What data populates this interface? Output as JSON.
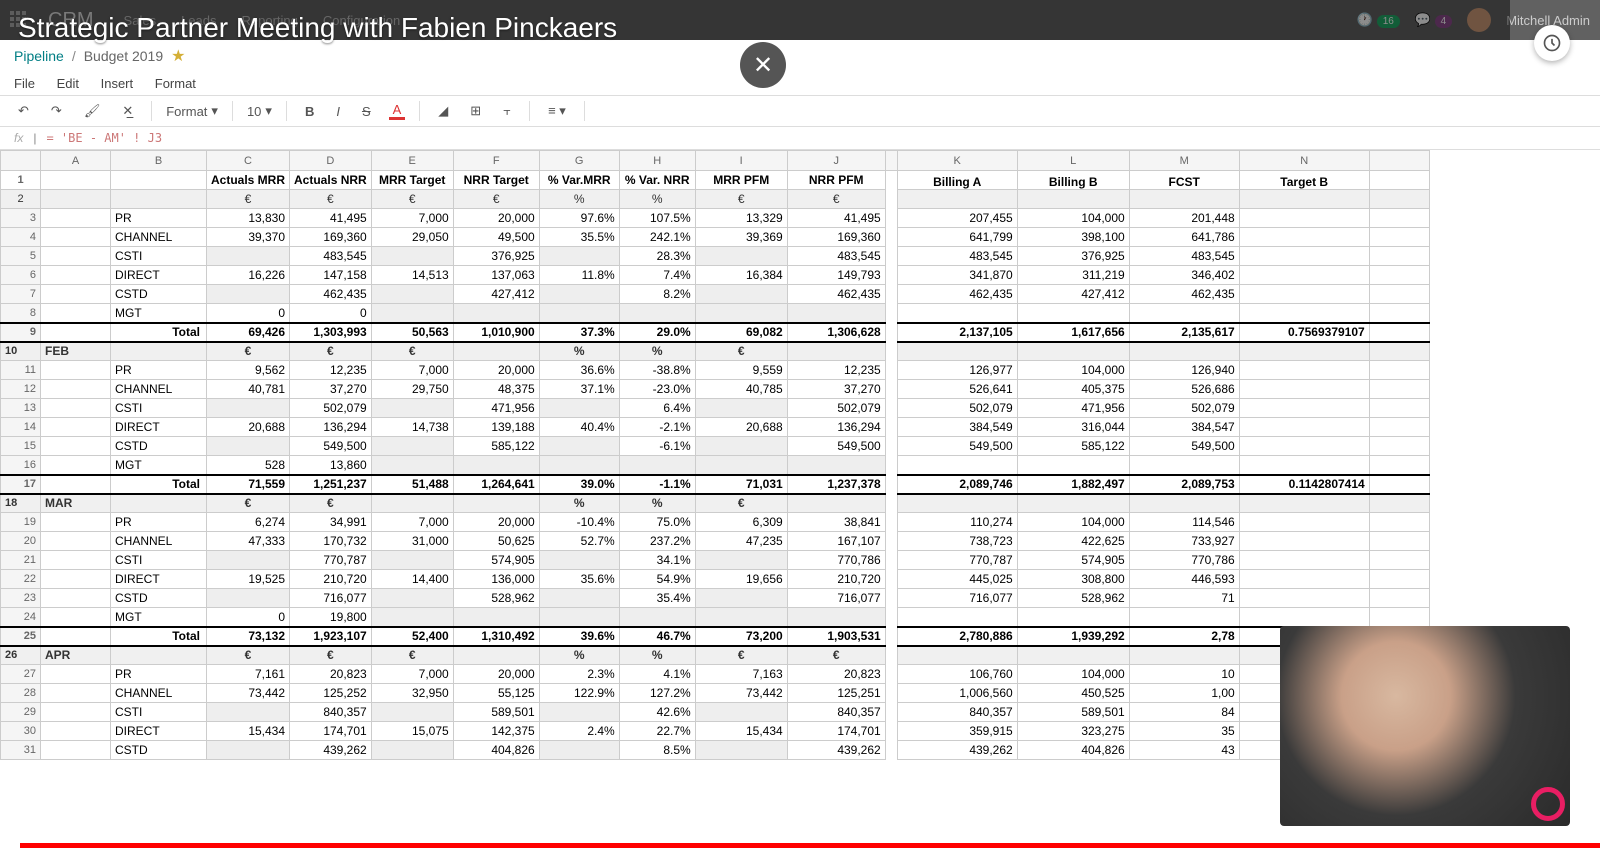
{
  "topbar": {
    "app": "CRM",
    "nav": [
      "Sales",
      "Leads",
      "Reporting",
      "Configuration"
    ],
    "badge1": "16",
    "badge2": "4",
    "user": "Mitchell Admin"
  },
  "overlay_title": "Strategic Partner Meeting with Fabien Pinckaers",
  "breadcrumb": {
    "root": "Pipeline",
    "current": "Budget 2019"
  },
  "menus": [
    "File",
    "Edit",
    "Insert",
    "Format"
  ],
  "toolbar": {
    "format": "Format",
    "size": "10"
  },
  "fx": {
    "label": "fx",
    "formula": "= 'BE - AM' ! J3"
  },
  "columns": [
    "",
    "A",
    "B",
    "C",
    "D",
    "E",
    "F",
    "G",
    "H",
    "I",
    "J",
    "",
    "K",
    "L",
    "M",
    "N",
    ""
  ],
  "header_row": [
    "",
    "",
    "",
    "Actuals MRR",
    "Actuals NRR",
    "MRR Target",
    "NRR Target",
    "% Var.MRR",
    "% Var. NRR",
    "MRR PFM",
    "NRR PFM",
    "",
    "Billing A",
    "Billing B",
    "FCST",
    "Target B",
    ""
  ],
  "unit_row": [
    "",
    "",
    "",
    "€",
    "€",
    "€",
    "€",
    "%",
    "%",
    "€",
    "€",
    "",
    "",
    "",
    "",
    "",
    ""
  ],
  "rows": [
    {
      "n": 3,
      "lbl": "PR",
      "c": [
        "13,830",
        "41,495",
        "7,000",
        "20,000",
        "97.6%",
        "107.5%",
        "13,329",
        "41,495",
        "",
        "207,455",
        "104,000",
        "201,448",
        "",
        ""
      ]
    },
    {
      "n": 4,
      "lbl": "CHANNEL",
      "c": [
        "39,370",
        "169,360",
        "29,050",
        "49,500",
        "35.5%",
        "242.1%",
        "39,369",
        "169,360",
        "",
        "641,799",
        "398,100",
        "641,786",
        "",
        ""
      ],
      "sel": 9
    },
    {
      "n": 5,
      "lbl": "CSTI",
      "c": [
        "",
        "483,545",
        "",
        "376,925",
        "",
        "28.3%",
        "",
        "483,545",
        "",
        "483,545",
        "376,925",
        "483,545",
        "",
        ""
      ]
    },
    {
      "n": 6,
      "lbl": "DIRECT",
      "c": [
        "16,226",
        "147,158",
        "14,513",
        "137,063",
        "11.8%",
        "7.4%",
        "16,384",
        "149,793",
        "",
        "341,870",
        "311,219",
        "346,402",
        "",
        ""
      ]
    },
    {
      "n": 7,
      "lbl": "CSTD",
      "c": [
        "",
        "462,435",
        "",
        "427,412",
        "",
        "8.2%",
        "",
        "462,435",
        "",
        "462,435",
        "427,412",
        "462,435",
        "",
        ""
      ]
    },
    {
      "n": 8,
      "lbl": "MGT",
      "c": [
        "0",
        "0",
        "",
        "",
        "",
        "",
        "",
        "",
        "",
        "",
        "",
        "",
        "",
        ""
      ]
    },
    {
      "n": 9,
      "lbl": "Total",
      "total": true,
      "c": [
        "69,426",
        "1,303,993",
        "50,563",
        "1,010,900",
        "37.3%",
        "29.0%",
        "69,082",
        "1,306,628",
        "",
        "2,137,105",
        "1,617,656",
        "2,135,617",
        "0.7569379107",
        ""
      ]
    },
    {
      "n": 10,
      "month": "FEB",
      "c": [
        "€",
        "€",
        "€",
        "",
        "%",
        "%",
        "€",
        "",
        "",
        "",
        "",
        "",
        "",
        ""
      ]
    },
    {
      "n": 11,
      "lbl": "PR",
      "c": [
        "9,562",
        "12,235",
        "7,000",
        "20,000",
        "36.6%",
        "-38.8%",
        "9,559",
        "12,235",
        "",
        "126,977",
        "104,000",
        "126,940",
        "",
        ""
      ]
    },
    {
      "n": 12,
      "lbl": "CHANNEL",
      "c": [
        "40,781",
        "37,270",
        "29,750",
        "48,375",
        "37.1%",
        "-23.0%",
        "40,785",
        "37,270",
        "",
        "526,641",
        "405,375",
        "526,686",
        "",
        ""
      ]
    },
    {
      "n": 13,
      "lbl": "CSTI",
      "c": [
        "",
        "502,079",
        "",
        "471,956",
        "",
        "6.4%",
        "",
        "502,079",
        "",
        "502,079",
        "471,956",
        "502,079",
        "",
        ""
      ]
    },
    {
      "n": 14,
      "lbl": "DIRECT",
      "c": [
        "20,688",
        "136,294",
        "14,738",
        "139,188",
        "40.4%",
        "-2.1%",
        "20,688",
        "136,294",
        "",
        "384,549",
        "316,044",
        "384,547",
        "",
        ""
      ]
    },
    {
      "n": 15,
      "lbl": "CSTD",
      "c": [
        "",
        "549,500",
        "",
        "585,122",
        "",
        "-6.1%",
        "",
        "549,500",
        "",
        "549,500",
        "585,122",
        "549,500",
        "",
        ""
      ]
    },
    {
      "n": 16,
      "lbl": "MGT",
      "c": [
        "528",
        "13,860",
        "",
        "",
        "",
        "",
        "",
        "",
        "",
        "",
        "",
        "",
        "",
        ""
      ]
    },
    {
      "n": 17,
      "lbl": "Total",
      "total": true,
      "c": [
        "71,559",
        "1,251,237",
        "51,488",
        "1,264,641",
        "39.0%",
        "-1.1%",
        "71,031",
        "1,237,378",
        "",
        "2,089,746",
        "1,882,497",
        "2,089,753",
        "0.1142807414",
        ""
      ]
    },
    {
      "n": 18,
      "month": "MAR",
      "c": [
        "€",
        "€",
        "",
        "",
        "%",
        "%",
        "€",
        "",
        "",
        "",
        "",
        "",
        "",
        ""
      ]
    },
    {
      "n": 19,
      "lbl": "PR",
      "c": [
        "6,274",
        "34,991",
        "7,000",
        "20,000",
        "-10.4%",
        "75.0%",
        "6,309",
        "38,841",
        "",
        "110,274",
        "104,000",
        "114,546",
        "",
        ""
      ]
    },
    {
      "n": 20,
      "lbl": "CHANNEL",
      "c": [
        "47,333",
        "170,732",
        "31,000",
        "50,625",
        "52.7%",
        "237.2%",
        "47,235",
        "167,107",
        "",
        "738,723",
        "422,625",
        "733,927",
        "",
        ""
      ]
    },
    {
      "n": 21,
      "lbl": "CSTI",
      "c": [
        "",
        "770,787",
        "",
        "574,905",
        "",
        "34.1%",
        "",
        "770,786",
        "",
        "770,787",
        "574,905",
        "770,786",
        "",
        ""
      ]
    },
    {
      "n": 22,
      "lbl": "DIRECT",
      "c": [
        "19,525",
        "210,720",
        "14,400",
        "136,000",
        "35.6%",
        "54.9%",
        "19,656",
        "210,720",
        "",
        "445,025",
        "308,800",
        "446,593",
        "",
        ""
      ]
    },
    {
      "n": 23,
      "lbl": "CSTD",
      "c": [
        "",
        "716,077",
        "",
        "528,962",
        "",
        "35.4%",
        "",
        "716,077",
        "",
        "716,077",
        "528,962",
        "71",
        "",
        ""
      ]
    },
    {
      "n": 24,
      "lbl": "MGT",
      "c": [
        "0",
        "19,800",
        "",
        "",
        "",
        "",
        "",
        "",
        "",
        "",
        "",
        "",
        "",
        ""
      ]
    },
    {
      "n": 25,
      "lbl": "Total",
      "total": true,
      "c": [
        "73,132",
        "1,923,107",
        "52,400",
        "1,310,492",
        "39.6%",
        "46.7%",
        "73,200",
        "1,903,531",
        "",
        "2,780,886",
        "1,939,292",
        "2,78",
        "",
        ""
      ]
    },
    {
      "n": 26,
      "month": "APR",
      "c": [
        "€",
        "€",
        "€",
        "",
        "%",
        "%",
        "€",
        "€",
        "",
        "",
        "",
        "",
        "",
        ""
      ]
    },
    {
      "n": 27,
      "lbl": "PR",
      "c": [
        "7,161",
        "20,823",
        "7,000",
        "20,000",
        "2.3%",
        "4.1%",
        "7,163",
        "20,823",
        "",
        "106,760",
        "104,000",
        "10",
        "",
        ""
      ]
    },
    {
      "n": 28,
      "lbl": "CHANNEL",
      "c": [
        "73,442",
        "125,252",
        "32,950",
        "55,125",
        "122.9%",
        "127.2%",
        "73,442",
        "125,251",
        "",
        "1,006,560",
        "450,525",
        "1,00",
        "",
        ""
      ]
    },
    {
      "n": 29,
      "lbl": "CSTI",
      "c": [
        "",
        "840,357",
        "",
        "589,501",
        "",
        "42.6%",
        "",
        "840,357",
        "",
        "840,357",
        "589,501",
        "84",
        "",
        ""
      ]
    },
    {
      "n": 30,
      "lbl": "DIRECT",
      "c": [
        "15,434",
        "174,701",
        "15,075",
        "142,375",
        "2.4%",
        "22.7%",
        "15,434",
        "174,701",
        "",
        "359,915",
        "323,275",
        "35",
        "",
        ""
      ]
    },
    {
      "n": 31,
      "lbl": "CSTD",
      "c": [
        "",
        "439,262",
        "",
        "404,826",
        "",
        "8.5%",
        "",
        "439,262",
        "",
        "439,262",
        "404,826",
        "43",
        "",
        ""
      ]
    }
  ]
}
